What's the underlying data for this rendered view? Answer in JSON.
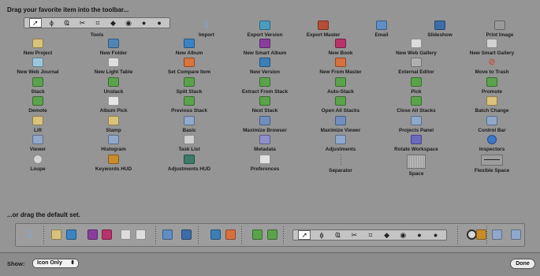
{
  "header": {
    "drag_title": "Drag your favorite item into the toolbar...",
    "default_title": "...or drag the default set."
  },
  "tools_label": "Tools",
  "tools_glyphs": [
    "➚",
    "ɸ",
    "Ҩ",
    "✂",
    "⌗",
    "◆",
    "◉",
    "●",
    "●"
  ],
  "items": [
    {
      "label": "Import",
      "icon": "import-icon",
      "color": "#7fa9d8"
    },
    {
      "label": "Export Version",
      "icon": "export-version-icon",
      "color": "#4b9cc0"
    },
    {
      "label": "Export Master",
      "icon": "export-master-icon",
      "color": "#b44e36"
    },
    {
      "label": "Email",
      "icon": "email-icon",
      "color": "#5f8dc6"
    },
    {
      "label": "Slideshow",
      "icon": "slideshow-icon",
      "color": "#3b6ea8"
    },
    {
      "label": "Print Image",
      "icon": "print-image-icon",
      "color": "#9a9a9a"
    },
    {
      "label": "New Project",
      "icon": "new-project-icon",
      "color": "#d9c27a"
    },
    {
      "label": "New Folder",
      "icon": "new-folder-icon",
      "color": "#4f86b8"
    },
    {
      "label": "New Album",
      "icon": "new-album-icon",
      "color": "#3a84c3"
    },
    {
      "label": "New Smart Album",
      "icon": "new-smart-album-icon",
      "color": "#8a3e9c"
    },
    {
      "label": "New Book",
      "icon": "new-book-icon",
      "color": "#b7336a"
    },
    {
      "label": "New Web Gallery",
      "icon": "new-web-gallery-icon",
      "color": "#dcdcdc"
    },
    {
      "label": "New Smart Gallery",
      "icon": "new-smart-gallery-icon",
      "color": "#d2d2d2"
    },
    {
      "label": "New Web Journal",
      "icon": "new-web-journal-icon",
      "color": "#9cc6de"
    },
    {
      "label": "New Light Table",
      "icon": "new-light-table-icon",
      "color": "#dedede"
    },
    {
      "label": "Set Compare Item",
      "icon": "set-compare-item-icon",
      "color": "#d9743a"
    },
    {
      "label": "New Version",
      "icon": "new-version-icon",
      "color": "#3a7fb8"
    },
    {
      "label": "New From Master",
      "icon": "new-from-master-icon",
      "color": "#d8703c"
    },
    {
      "label": "External Editor",
      "icon": "external-editor-icon",
      "color": "#b0b0b0"
    },
    {
      "label": "Move to Trash",
      "icon": "move-to-trash-icon",
      "color": "#d63a2a"
    },
    {
      "label": "Stack",
      "icon": "stack-icon",
      "color": "#5aa34b"
    },
    {
      "label": "Unstack",
      "icon": "unstack-icon",
      "color": "#5aa34b"
    },
    {
      "label": "Split Stack",
      "icon": "split-stack-icon",
      "color": "#5aa34b"
    },
    {
      "label": "Extract From Stack",
      "icon": "extract-from-stack-icon",
      "color": "#5aa34b"
    },
    {
      "label": "Auto-Stack",
      "icon": "auto-stack-icon",
      "color": "#5aa34b"
    },
    {
      "label": "Pick",
      "icon": "pick-icon",
      "color": "#5aa34b"
    },
    {
      "label": "Promote",
      "icon": "promote-icon",
      "color": "#5aa34b"
    },
    {
      "label": "Demote",
      "icon": "demote-icon",
      "color": "#5aa34b"
    },
    {
      "label": "Album Pick",
      "icon": "album-pick-icon",
      "color": "#e6e6e6"
    },
    {
      "label": "Previous Stack",
      "icon": "previous-stack-icon",
      "color": "#5aa34b"
    },
    {
      "label": "Next Stack",
      "icon": "next-stack-icon",
      "color": "#5aa34b"
    },
    {
      "label": "Open All Stacks",
      "icon": "open-all-stacks-icon",
      "color": "#5aa34b"
    },
    {
      "label": "Close All Stacks",
      "icon": "close-all-stacks-icon",
      "color": "#5aa34b"
    },
    {
      "label": "Batch Change",
      "icon": "batch-change-icon",
      "color": "#d9c27a"
    },
    {
      "label": "Lift",
      "icon": "lift-icon",
      "color": "#d9c27a"
    },
    {
      "label": "Stamp",
      "icon": "stamp-icon",
      "color": "#d9c27a"
    },
    {
      "label": "Basic",
      "icon": "basic-icon",
      "color": "#8fa8cc"
    },
    {
      "label": "Maximize Browser",
      "icon": "maximize-browser-icon",
      "color": "#6f8fbf"
    },
    {
      "label": "Maximize Viewer",
      "icon": "maximize-viewer-icon",
      "color": "#6f8fbf"
    },
    {
      "label": "Projects Panel",
      "icon": "projects-panel-icon",
      "color": "#8fa8cc"
    },
    {
      "label": "Control Bar",
      "icon": "control-bar-icon",
      "color": "#8fa8cc"
    },
    {
      "label": "Viewer",
      "icon": "viewer-icon",
      "color": "#8fa8cc"
    },
    {
      "label": "Histogram",
      "icon": "histogram-icon",
      "color": "#8fa8cc"
    },
    {
      "label": "Task List",
      "icon": "task-list-icon",
      "color": "#cfcfcf"
    },
    {
      "label": "Metadata",
      "icon": "metadata-icon",
      "color": "#8f8fcc"
    },
    {
      "label": "Adjustments",
      "icon": "adjustments-icon",
      "color": "#8fa8cc"
    },
    {
      "label": "Rotate Workspace",
      "icon": "rotate-workspace-icon",
      "color": "#6a6ac0"
    },
    {
      "label": "Inspectors",
      "icon": "inspectors-icon",
      "color": "#3b78c9"
    },
    {
      "label": "Loupe",
      "icon": "loupe-icon",
      "color": "#d4d4d4"
    },
    {
      "label": "Keywords HUD",
      "icon": "keywords-hud-icon",
      "color": "#c98c2a"
    },
    {
      "label": "Adjustments HUD",
      "icon": "adjustments-hud-icon",
      "color": "#3d7a6a"
    },
    {
      "label": "Preferences",
      "icon": "preferences-icon",
      "color": "#e0e0e0"
    },
    {
      "label": "Separator",
      "icon": "separator-icon",
      "color": ""
    },
    {
      "label": "Space",
      "icon": "space-icon",
      "color": ""
    },
    {
      "label": "Flexible Space",
      "icon": "flexible-space-icon",
      "color": ""
    }
  ],
  "default_set": [
    {
      "icon": "import-icon",
      "color": "#7fa9d8"
    },
    {
      "icon": "new-project-icon",
      "color": "#d9c27a"
    },
    {
      "icon": "new-album-icon",
      "color": "#3a84c3"
    },
    {
      "icon": "new-smart-album-icon",
      "color": "#8a3e9c"
    },
    {
      "icon": "new-book-icon",
      "color": "#b7336a"
    },
    {
      "icon": "new-web-gallery-icon",
      "color": "#dcdcdc"
    },
    {
      "icon": "new-light-table-icon",
      "color": "#dedede"
    },
    {
      "icon": "email-icon",
      "color": "#5f8dc6"
    },
    {
      "icon": "slideshow-icon",
      "color": "#3b6ea8"
    },
    {
      "icon": "new-version-icon",
      "color": "#3a7fb8"
    },
    {
      "icon": "new-from-master-icon",
      "color": "#d8703c"
    },
    {
      "icon": "stack-icon",
      "color": "#5aa34b"
    },
    {
      "icon": "pick-icon",
      "color": "#5aa34b"
    },
    {
      "icon": "keywords-hud-icon",
      "color": "#c98c2a"
    },
    {
      "icon": "basic-icon",
      "color": "#8fa8cc"
    },
    {
      "icon": "viewer-icon",
      "color": "#8fa8cc"
    }
  ],
  "footer": {
    "show_label": "Show:",
    "show_value": "Icon Only",
    "done_label": "Done"
  }
}
